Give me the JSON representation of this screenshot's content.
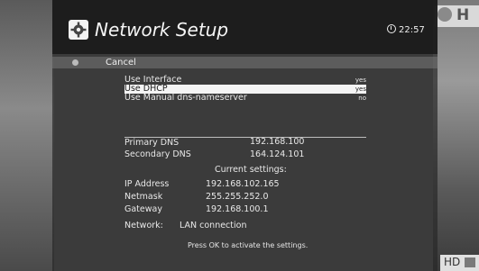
{
  "header": {
    "title": "Network Setup",
    "time": "22:57"
  },
  "menu": {
    "cancel_label": "Cancel"
  },
  "options": [
    {
      "label": "Use Interface",
      "value": "yes",
      "selected": false
    },
    {
      "label": "Use DHCP",
      "value": "yes",
      "selected": true
    },
    {
      "label": "Use Manual dns-nameserver",
      "value": "no",
      "selected": false
    }
  ],
  "dns": {
    "primary_label": "Primary DNS",
    "primary_value": "192.168.100",
    "secondary_label": "Secondary DNS",
    "secondary_value": "164.124.101"
  },
  "current": {
    "heading": "Current settings:",
    "ip_label": "IP Address",
    "ip_value": "192.168.102.165",
    "netmask_label": "Netmask",
    "netmask_value": "255.255.252.0",
    "gateway_label": "Gateway",
    "gateway_value": "192.168.100.1",
    "network_label": "Network:",
    "network_value": "LAN connection"
  },
  "footer": {
    "hint": "Press OK to activate the settings."
  },
  "overlay": {
    "channel_logo": "H",
    "hd_badge": "HD"
  },
  "colors": {
    "panel": "#2a2a2a",
    "highlight": "#f4f4f4",
    "text": "#e8e8e8"
  },
  "icons": {
    "title_icon": "gear-icon",
    "clock_icon": "clock-icon"
  }
}
